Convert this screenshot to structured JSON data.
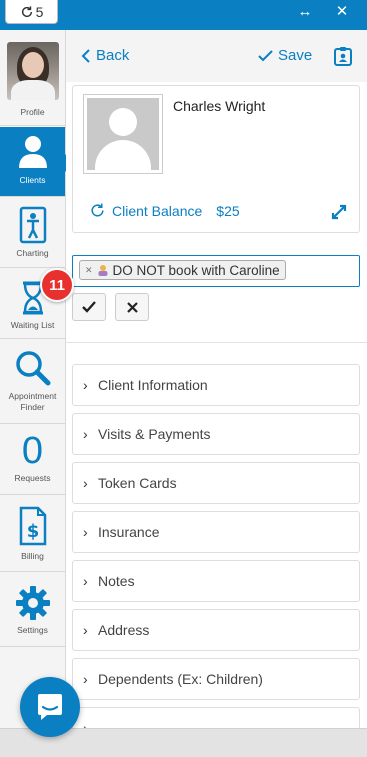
{
  "topbar": {
    "refresh_count": "5",
    "expand_icon": "double-arrow-icon",
    "close_icon": "close-icon"
  },
  "sidebar": {
    "items": [
      {
        "label": "Profile",
        "icon": "profile-photo"
      },
      {
        "label": "Clients",
        "icon": "person-icon",
        "active": true
      },
      {
        "label": "Charting",
        "icon": "chart-figure-icon"
      },
      {
        "label": "Waiting List",
        "icon": "hourglass-icon"
      },
      {
        "label": "Appointment\nFinder",
        "icon": "magnifier-icon"
      },
      {
        "label": "Requests",
        "icon": "count",
        "count": "0"
      },
      {
        "label": "Billing",
        "icon": "invoice-dollar-icon"
      },
      {
        "label": "Settings",
        "icon": "gear-icon"
      }
    ],
    "badge": "11"
  },
  "header": {
    "back_label": "Back",
    "save_label": "Save"
  },
  "client": {
    "name": "Charles Wright",
    "balance_label": "Client Balance",
    "balance_amount": "$25"
  },
  "alert_tag": {
    "text": "DO NOT book with Caroline"
  },
  "sections": [
    "Client Information",
    "Visits & Payments",
    "Token Cards",
    "Insurance",
    "Notes",
    "Address",
    "Dependents (Ex: Children)"
  ],
  "colors": {
    "accent": "#0a7fc2",
    "badge": "#e8312f"
  }
}
